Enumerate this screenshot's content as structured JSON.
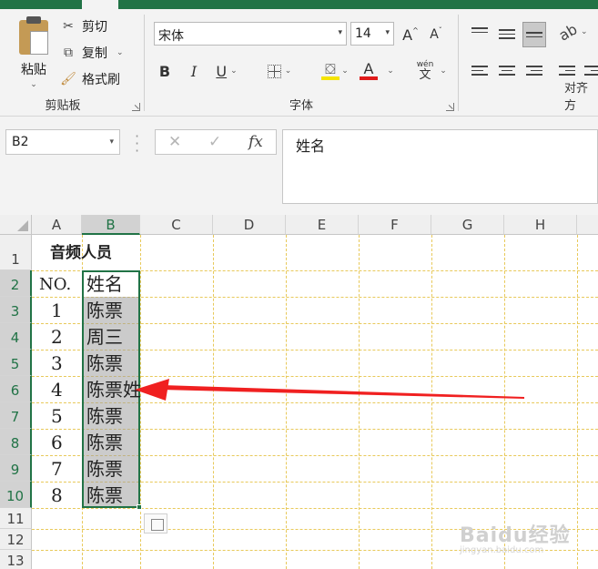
{
  "ribbon": {
    "clipboard": {
      "paste_label": "粘贴",
      "cut_label": "剪切",
      "copy_label": "复制",
      "format_painter_label": "格式刷",
      "group_label": "剪贴板"
    },
    "font": {
      "font_name": "宋体",
      "font_size": "14",
      "grow_label": "A",
      "shrink_label": "A",
      "bold_label": "B",
      "italic_label": "I",
      "underline_label": "U",
      "font_color_label": "A",
      "phonetic_top": "wén",
      "phonetic_bottom": "文",
      "group_label": "字体",
      "fill_color": "#f5e400",
      "font_color": "#e01b1b"
    },
    "alignment": {
      "group_label": "对齐方"
    }
  },
  "formula_bar": {
    "name_box": "B2",
    "cancel_label": "✕",
    "enter_label": "✓",
    "fx_label": "fx",
    "content": "姓名"
  },
  "sheet": {
    "columns": [
      "A",
      "B",
      "C",
      "D",
      "E",
      "F",
      "G",
      "H"
    ],
    "rows": [
      "1",
      "2",
      "3",
      "4",
      "5",
      "6",
      "7",
      "8",
      "9",
      "10",
      "11",
      "12",
      "13"
    ],
    "selected_column": "B",
    "selected_rows": [
      "2",
      "3",
      "4",
      "5",
      "6",
      "7",
      "8",
      "9",
      "10"
    ],
    "title": "音频人员",
    "header_no": "NO.",
    "header_name": "姓名",
    "data": [
      {
        "no": "1",
        "name": "陈票"
      },
      {
        "no": "2",
        "name": "周三"
      },
      {
        "no": "3",
        "name": "陈票"
      },
      {
        "no": "4",
        "name": "陈票姓"
      },
      {
        "no": "5",
        "name": "陈票"
      },
      {
        "no": "6",
        "name": "陈票"
      },
      {
        "no": "7",
        "name": "陈票"
      },
      {
        "no": "8",
        "name": "陈票"
      }
    ]
  },
  "annotation": {
    "arrow_color": "#f02020"
  },
  "watermark": {
    "text": "Baidu经验",
    "sub": "jingyan.baidu.com"
  },
  "colors": {
    "excel_green": "#217346",
    "gridline": "#e8c95a"
  }
}
